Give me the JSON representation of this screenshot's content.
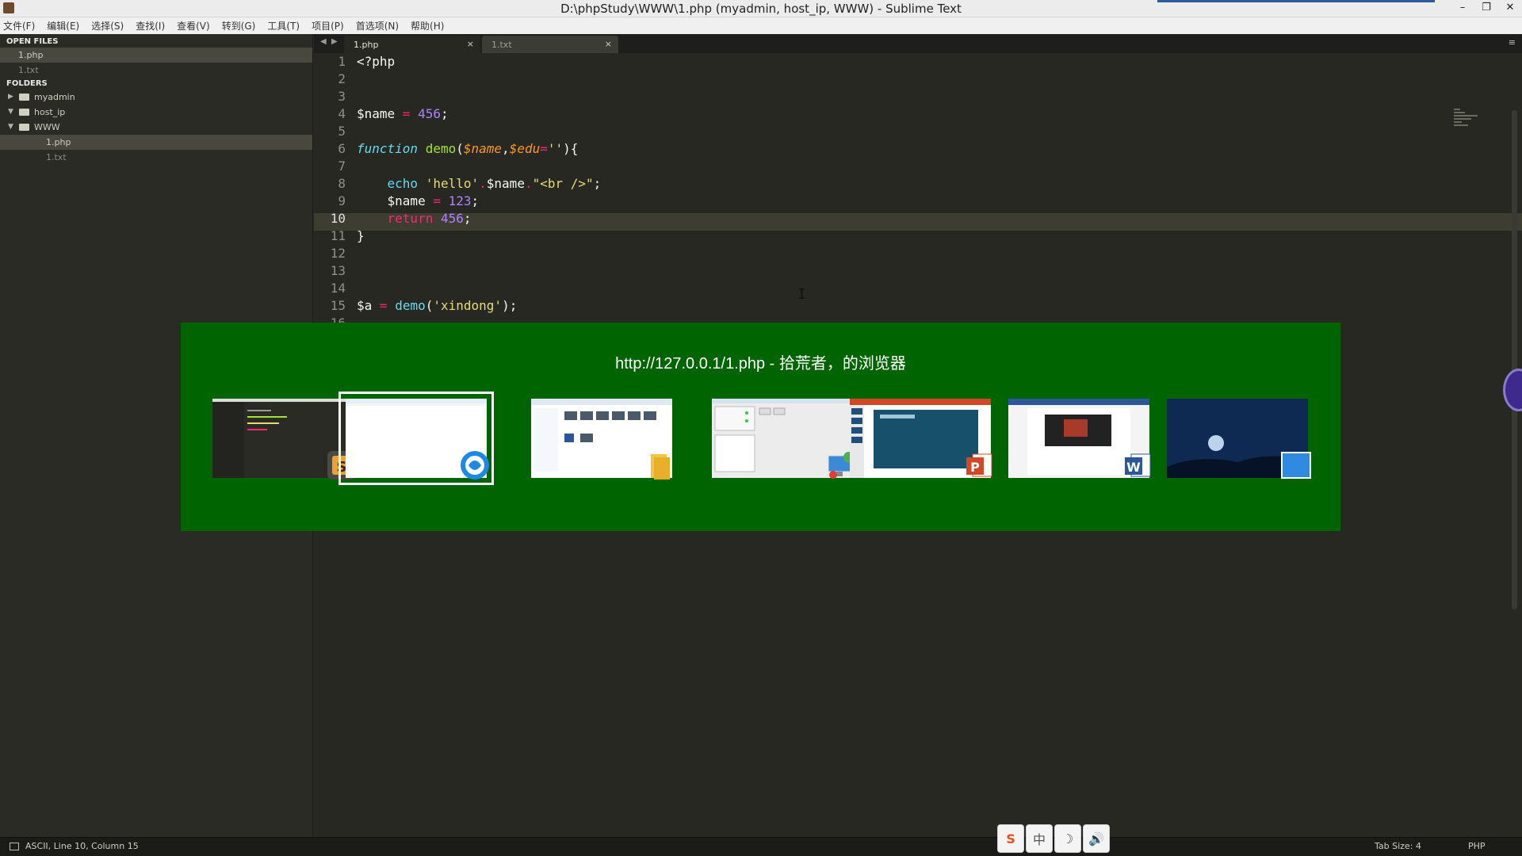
{
  "window": {
    "title": "D:\\phpStudy\\WWW\\1.php (myadmin, host_ip, WWW) - Sublime Text",
    "controls": {
      "minimize": "–",
      "restore": "❐",
      "close": "✕"
    }
  },
  "menu": [
    "文件(F)",
    "编辑(E)",
    "选择(S)",
    "查找(I)",
    "查看(V)",
    "转到(G)",
    "工具(T)",
    "项目(P)",
    "首选项(N)",
    "帮助(H)"
  ],
  "sidebar": {
    "open_files_header": "OPEN FILES",
    "open_files": [
      {
        "name": "1.php",
        "active": true
      },
      {
        "name": "1.txt",
        "active": false
      }
    ],
    "folders_header": "FOLDERS",
    "folders": [
      {
        "name": "myadmin",
        "expanded": false
      },
      {
        "name": "host_ip",
        "expanded": true
      },
      {
        "name": "WWW",
        "expanded": true
      }
    ],
    "www_files": [
      {
        "name": "1.php",
        "active": true
      },
      {
        "name": "1.txt",
        "active": false
      }
    ]
  },
  "tabs": [
    {
      "label": "1.php",
      "close": "×",
      "active": true
    },
    {
      "label": "1.txt",
      "close": "×",
      "active": false
    }
  ],
  "tab_nav": {
    "back": "◀",
    "forward": "▶",
    "menu": "≡"
  },
  "editor": {
    "current_line": 10,
    "line_numbers": [
      "1",
      "2",
      "3",
      "4",
      "5",
      "6",
      "7",
      "8",
      "9",
      "10",
      "11",
      "12",
      "13",
      "14",
      "15",
      "16"
    ],
    "ibeam_glyph": "I"
  },
  "task_switcher": {
    "title": "http://127.0.0.1/1.php - 拾荒者，的浏览器",
    "background_color": "#006400",
    "selected_index": 1,
    "windows": [
      {
        "icon": "sublime-text-icon"
      },
      {
        "icon": "sogou-browser-icon"
      },
      {
        "icon": "file-explorer-icon"
      },
      {
        "icon": "phpstudy-icon"
      },
      {
        "icon": "powerpoint-icon"
      },
      {
        "icon": "word-icon"
      },
      {
        "icon": "desktop-icon"
      }
    ]
  },
  "status_bar": {
    "left": "ASCII, Line 10, Column 15",
    "tab_size": "Tab Size: 4",
    "syntax": "PHP"
  },
  "ime_bar": {
    "items": [
      "S",
      "中",
      "☽",
      "🔊"
    ]
  }
}
